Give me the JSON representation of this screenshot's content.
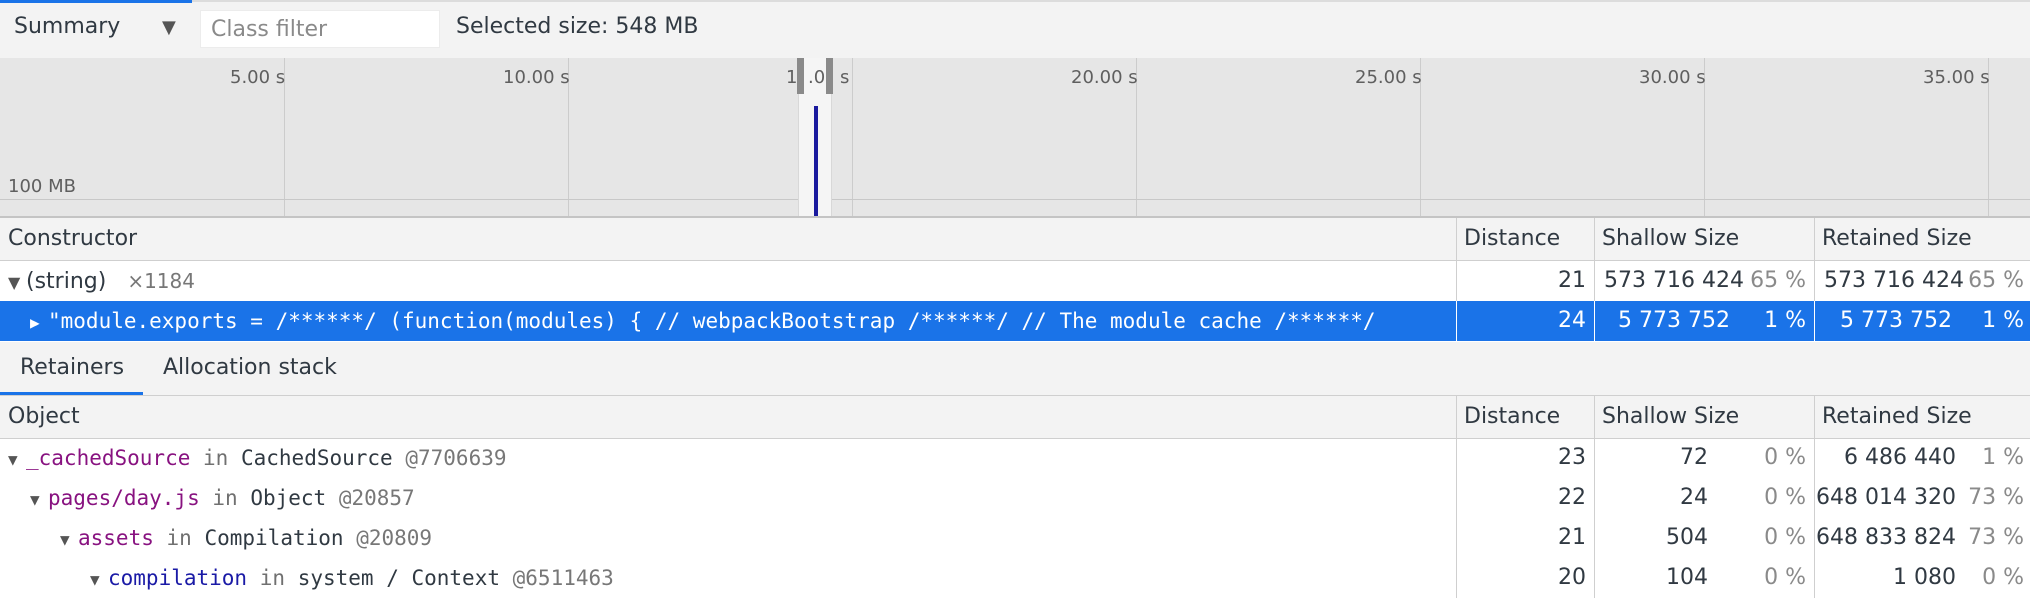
{
  "toolbar": {
    "view_label": "Summary",
    "view_dropdown_icon": "triangle-down",
    "class_filter_placeholder": "Class filter",
    "class_filter_value": "",
    "selected_size": "Selected size: 548 MB"
  },
  "timeline": {
    "ticks": [
      "5.00 s",
      "10.00 s",
      "15.00 s",
      "20.00 s",
      "25.00 s",
      "30.00 s",
      "35.00 s"
    ],
    "partially_hidden_tick": {
      "visible_left": "1",
      "visible_mid": ".0",
      "visible_right": "s"
    },
    "memory_label": "100 MB",
    "selection_bar_color": "#1a1a9e"
  },
  "constructor_grid": {
    "headers": {
      "constructor": "Constructor",
      "distance": "Distance",
      "shallow": "Shallow Size",
      "retained": "Retained Size"
    },
    "rows": [
      {
        "name": "(string)",
        "count": "×1184",
        "distance": "21",
        "shallow": "573 716 424",
        "shallow_pct": "65 %",
        "retained": "573 716 424",
        "retained_pct": "65 %"
      },
      {
        "name": "\"module.exports = /******/ (function(modules) { // webpackBootstrap /******/ // The module cache /******/",
        "distance": "24",
        "shallow": "5 773 752",
        "shallow_pct": "1 %",
        "retained": "5 773 752",
        "retained_pct": "1 %"
      }
    ]
  },
  "tabs": {
    "retainers": "Retainers",
    "allocation": "Allocation stack"
  },
  "retainers_grid": {
    "headers": {
      "object": "Object",
      "distance": "Distance",
      "shallow": "Shallow Size",
      "retained": "Retained Size"
    },
    "rows": [
      {
        "prop": "_cachedSource",
        "in": "in",
        "owner": "CachedSource",
        "id": "@7706639",
        "distance": "23",
        "shallow": "72",
        "shallow_pct": "0 %",
        "retained": "6 486 440",
        "retained_pct": "1 %"
      },
      {
        "prop": "pages/day.js",
        "in": "in",
        "owner": "Object",
        "id": "@20857",
        "distance": "22",
        "shallow": "24",
        "shallow_pct": "0 %",
        "retained": "648 014 320",
        "retained_pct": "73 %"
      },
      {
        "prop": "assets",
        "in": "in",
        "owner": "Compilation",
        "id": "@20809",
        "distance": "21",
        "shallow": "504",
        "shallow_pct": "0 %",
        "retained": "648 833 824",
        "retained_pct": "73 %"
      },
      {
        "prop": "compilation",
        "in": "in",
        "owner": "system / Context",
        "id": "@6511463",
        "distance": "20",
        "shallow": "104",
        "shallow_pct": "0 %",
        "retained": "1 080",
        "retained_pct": "0 %"
      }
    ]
  }
}
